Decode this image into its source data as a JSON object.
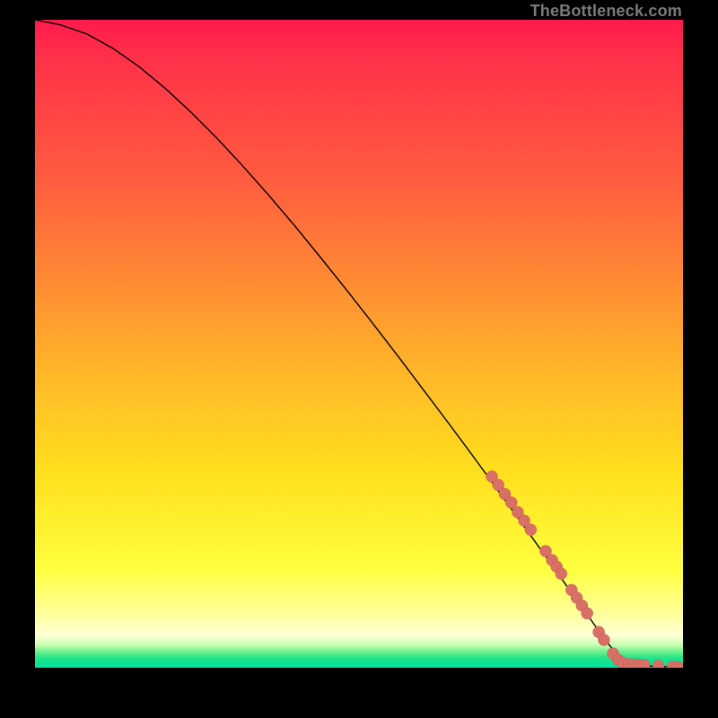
{
  "watermark": "TheBottleneck.com",
  "colors": {
    "curve": "#000000",
    "marker_fill": "#d97066",
    "marker_stroke": "#c45a52",
    "background_black": "#000000"
  },
  "chart_data": {
    "type": "line",
    "title": "",
    "xlabel": "",
    "ylabel": "",
    "xlim": [
      0,
      100
    ],
    "ylim": [
      0,
      100
    ],
    "grid": false,
    "legend": false,
    "series": [
      {
        "name": "curve",
        "x": [
          0,
          4,
          8,
          12,
          16,
          20,
          24,
          28,
          32,
          36,
          40,
          44,
          48,
          52,
          56,
          60,
          64,
          68,
          72,
          76,
          80,
          84,
          86,
          88,
          90,
          92,
          94,
          96,
          98,
          100
        ],
        "y": [
          100,
          99.2,
          97.8,
          95.6,
          92.8,
          89.5,
          85.8,
          81.8,
          77.5,
          73.0,
          68.3,
          63.4,
          58.4,
          53.3,
          48.1,
          42.8,
          37.5,
          32.1,
          26.6,
          21.1,
          15.5,
          9.9,
          7.1,
          4.3,
          1.8,
          0.6,
          0.3,
          0.2,
          0.15,
          0.1
        ]
      }
    ],
    "markers": [
      {
        "x": 70.5,
        "y": 29.5
      },
      {
        "x": 71.5,
        "y": 28.2
      },
      {
        "x": 72.5,
        "y": 26.8
      },
      {
        "x": 73.5,
        "y": 25.5
      },
      {
        "x": 74.5,
        "y": 24.0
      },
      {
        "x": 75.5,
        "y": 22.7
      },
      {
        "x": 76.5,
        "y": 21.3
      },
      {
        "x": 78.8,
        "y": 18.0
      },
      {
        "x": 79.8,
        "y": 16.6
      },
      {
        "x": 80.5,
        "y": 15.6
      },
      {
        "x": 81.2,
        "y": 14.5
      },
      {
        "x": 82.8,
        "y": 12.0
      },
      {
        "x": 83.6,
        "y": 10.8
      },
      {
        "x": 84.4,
        "y": 9.6
      },
      {
        "x": 85.2,
        "y": 8.4
      },
      {
        "x": 87.0,
        "y": 5.5
      },
      {
        "x": 87.8,
        "y": 4.3
      },
      {
        "x": 89.2,
        "y": 2.2
      },
      {
        "x": 90.0,
        "y": 1.2
      },
      {
        "x": 90.8,
        "y": 0.7
      },
      {
        "x": 91.6,
        "y": 0.55
      },
      {
        "x": 92.4,
        "y": 0.5
      },
      {
        "x": 93.2,
        "y": 0.45
      },
      {
        "x": 94.0,
        "y": 0.4
      },
      {
        "x": 96.2,
        "y": 0.3
      },
      {
        "x": 98.4,
        "y": 0.15
      },
      {
        "x": 99.2,
        "y": 0.1
      }
    ],
    "marker_radius_data_units": 0.9
  }
}
